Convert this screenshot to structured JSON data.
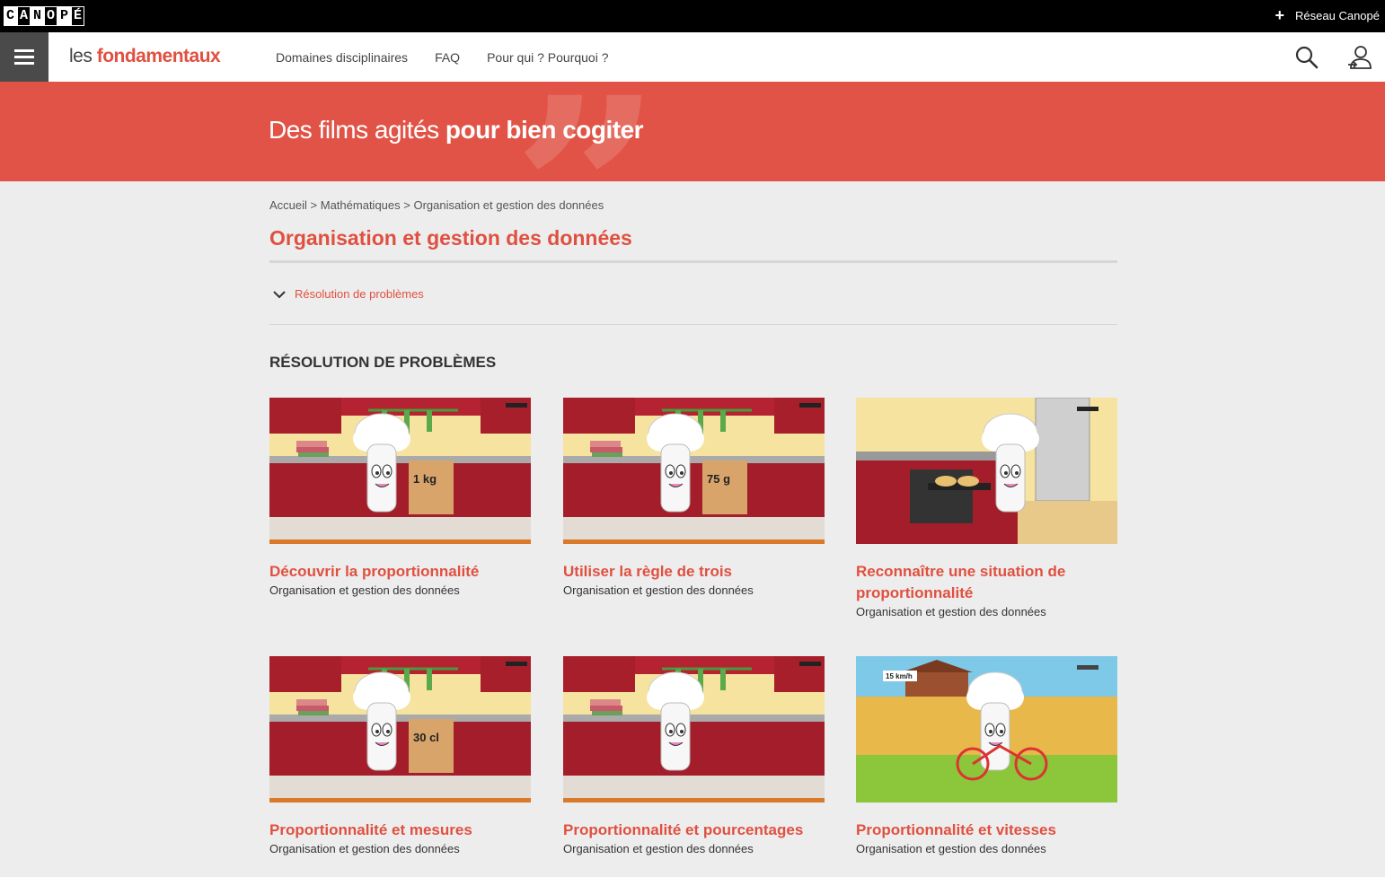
{
  "topbar": {
    "logo_letters": [
      "C",
      "A",
      "N",
      "O",
      "P",
      "É"
    ],
    "reseau_label": "Réseau Canopé"
  },
  "nav": {
    "brand_les": "les",
    "brand_fond": "fondamentaux",
    "links": [
      "Domaines disciplinaires",
      "FAQ",
      "Pour qui ? Pourquoi ?"
    ],
    "icons": [
      "menu-icon",
      "search-icon",
      "user-icon"
    ]
  },
  "banner": {
    "slogan_regular": "Des films agités ",
    "slogan_bold": "pour bien cogiter"
  },
  "breadcrumb": {
    "items": [
      "Accueil",
      "Mathématiques",
      "Organisation et gestion des données"
    ],
    "separator": " > "
  },
  "page": {
    "title": "Organisation et gestion des données",
    "toggle_label": "Résolution de problèmes",
    "section_title": "RÉSOLUTION DE PROBLÈMES"
  },
  "cards": [
    {
      "title": "Découvrir la proportionnalité",
      "subtitle": "Organisation et gestion des données",
      "scene": "kitchen",
      "label": "1 kg"
    },
    {
      "title": "Utiliser la règle de trois",
      "subtitle": "Organisation et gestion des données",
      "scene": "kitchen",
      "label": "75 g"
    },
    {
      "title": "Reconnaître une situation de proportionnalité",
      "subtitle": "Organisation et gestion des données",
      "scene": "oven",
      "label": ""
    },
    {
      "title": "Proportionnalité et mesures",
      "subtitle": "Organisation et gestion des données",
      "scene": "kitchen",
      "label": "30 cl"
    },
    {
      "title": "Proportionnalité et pourcentages",
      "subtitle": "Organisation et gestion des données",
      "scene": "kitchen",
      "label": ""
    },
    {
      "title": "Proportionnalité et vitesses",
      "subtitle": "Organisation et gestion des données",
      "scene": "field",
      "label": "15 km/h"
    }
  ],
  "colors": {
    "accent": "#e05040",
    "banner": "#e15346",
    "topbar": "#000000",
    "burger_bg": "#4a4a4a"
  }
}
